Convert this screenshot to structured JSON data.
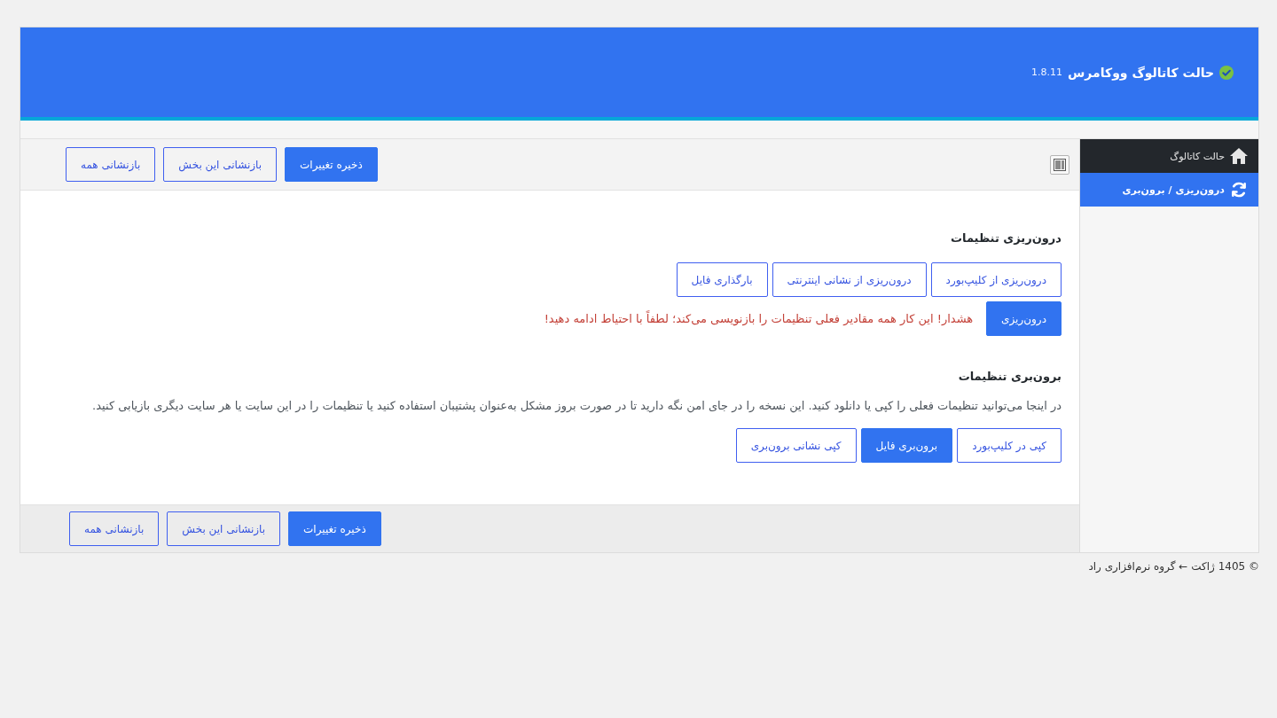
{
  "header": {
    "title": "حالت کاتالوگ ووکامرس",
    "version": "1.8.11"
  },
  "sidebar": {
    "items": [
      {
        "label": "حالت کاتالوگ",
        "selected": false
      },
      {
        "label": "درون‌ریزی / برون‌بری",
        "selected": true
      }
    ]
  },
  "toolbar": {
    "buttons": [
      {
        "label": "ذخیره تغییرات",
        "kind": "primary"
      },
      {
        "label": "بازنشانی این بخش",
        "kind": "outline"
      },
      {
        "label": "بازنشانی همه",
        "kind": "outline"
      }
    ]
  },
  "import_section": {
    "heading": "درون‌ریزی تنظیمات",
    "buttons": [
      {
        "label": "درون‌ریزی از کلیپ‌بورد",
        "kind": "outline"
      },
      {
        "label": "درون‌ریزی از نشانی اینترنتی",
        "kind": "outline"
      },
      {
        "label": "بارگذاری فایل",
        "kind": "outline"
      }
    ],
    "action": {
      "label": "درون‌ریزی",
      "kind": "primary"
    },
    "warning": "هشدار! این کار همه مقادیر فعلی تنظیمات را بازنویسی می‌کند؛ لطفاً با احتیاط ادامه دهید!"
  },
  "export_section": {
    "heading": "برون‌بری تنظیمات",
    "description": "در اینجا می‌توانید تنظیمات فعلی را کپی یا دانلود کنید. این نسخه را در جای امن نگه دارید تا در صورت بروز مشکل به‌عنوان پشتیبان استفاده کنید یا تنظیمات را در این سایت یا هر سایت دیگری بازیابی کنید.",
    "buttons": [
      {
        "label": "کپی در کلیپ‌بورد",
        "kind": "outline"
      },
      {
        "label": "برون‌بری فایل",
        "kind": "primary"
      },
      {
        "label": "کپی نشانی برون‌بری",
        "kind": "outline"
      }
    ]
  },
  "footer_bar": {
    "buttons": [
      {
        "label": "ذخیره تغییرات",
        "kind": "primary"
      },
      {
        "label": "بازنشانی این بخش",
        "kind": "outline"
      },
      {
        "label": "بازنشانی همه",
        "kind": "outline"
      }
    ]
  },
  "copyright": "© 1405 ژاکت ← گروه نرم‌افزاری راد"
}
